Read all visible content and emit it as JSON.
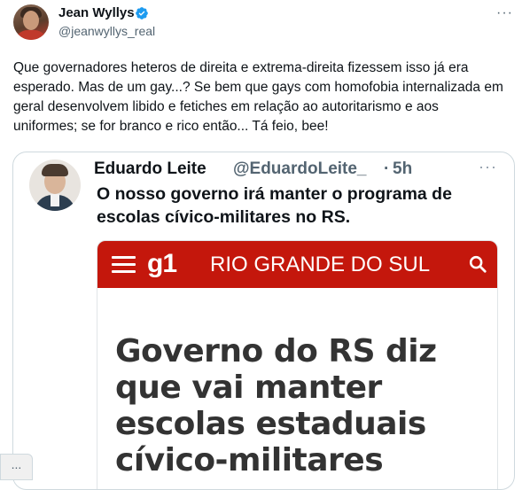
{
  "tweet": {
    "author_name": "Jean Wyllys",
    "author_handle": "@jeanwyllys_real",
    "more_label": "···",
    "text": "Que governadores heteros de direita e extrema-direita fizessem isso já era esperado. Mas de um gay...? Se bem que gays com homofobia internalizada em geral desenvolvem libido e fetiches em relação ao autoritarismo e aos uniformes; se for branco e rico então... Tá feio, bee!"
  },
  "quote": {
    "author_name": "Eduardo Leite",
    "author_handle": "@EduardoLeite_",
    "separator": "·",
    "time": "5h",
    "more_label": "···",
    "text": "O nosso governo irá manter o programa de escolas cívico-militares no RS."
  },
  "news": {
    "logo": "g1",
    "section": "RIO GRANDE DO SUL",
    "headline": "Governo do RS diz que vai manter escolas estaduais cívico-militares"
  },
  "overlay": {
    "label": "..."
  },
  "colors": {
    "g1_red": "#c4170c",
    "verified_blue": "#1d9bf0",
    "secondary_text": "#536471"
  },
  "icons": {
    "verified": "verified-badge-icon",
    "menu": "hamburger-menu-icon",
    "search": "search-icon"
  }
}
